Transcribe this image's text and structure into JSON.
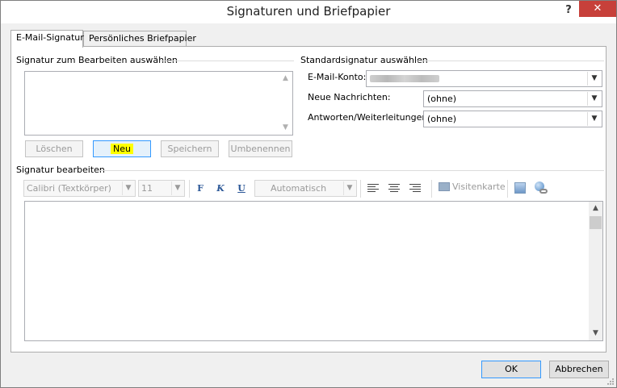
{
  "window": {
    "title": "Signaturen und Briefpapier",
    "help": "?",
    "close": "✕"
  },
  "tabs": [
    {
      "label": "E-Mail-Signatur",
      "active": true
    },
    {
      "label": "Persönliches Briefpapier",
      "active": false
    }
  ],
  "select_signature": {
    "group_label": "Signatur zum Bearbeiten auswählen",
    "buttons": {
      "delete": "Löschen",
      "new": "Neu",
      "save": "Speichern",
      "rename": "Umbenennen"
    }
  },
  "default_signature": {
    "group_label": "Standardsignatur auswählen",
    "account_label": "E-Mail-Konto:",
    "new_messages_label": "Neue Nachrichten:",
    "new_messages_value": "(ohne)",
    "replies_label": "Antworten/Weiterleitungen:",
    "replies_value": "(ohne)"
  },
  "edit_signature": {
    "group_label": "Signatur bearbeiten",
    "font": "Calibri (Textkörper)",
    "size": "11",
    "bold": "F",
    "italic": "K",
    "underline": "U",
    "color": "Automatisch",
    "business_card": "Visitenkarte"
  },
  "footer": {
    "ok": "OK",
    "cancel": "Abbrechen"
  },
  "colors": {
    "close_button": "#c7403a",
    "highlight": "#ffff00",
    "focus_border": "#3399ff"
  }
}
